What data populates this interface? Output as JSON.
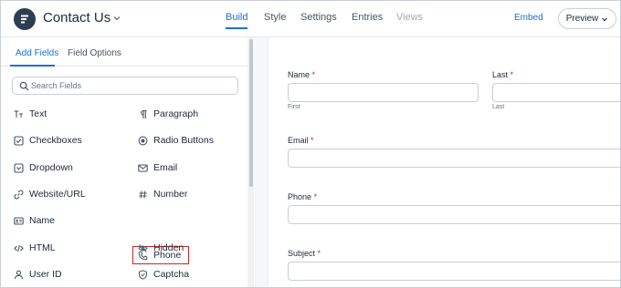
{
  "header": {
    "form_title": "Contact Us",
    "tabs": [
      {
        "label": "Build",
        "state": "active"
      },
      {
        "label": "Style",
        "state": "normal"
      },
      {
        "label": "Settings",
        "state": "normal"
      },
      {
        "label": "Entries",
        "state": "normal"
      },
      {
        "label": "Views",
        "state": "disabled"
      }
    ],
    "embed_label": "Embed",
    "preview_label": "Preview"
  },
  "sidebar": {
    "tabs": [
      {
        "label": "Add Fields",
        "state": "active"
      },
      {
        "label": "Field Options",
        "state": "normal"
      }
    ],
    "search_placeholder": "Search Fields",
    "fields": [
      {
        "label": "Text",
        "icon": "text-icon"
      },
      {
        "label": "Paragraph",
        "icon": "paragraph-icon"
      },
      {
        "label": "Checkboxes",
        "icon": "checkbox-icon"
      },
      {
        "label": "Radio Buttons",
        "icon": "radio-icon"
      },
      {
        "label": "Dropdown",
        "icon": "dropdown-icon"
      },
      {
        "label": "Email",
        "icon": "email-icon"
      },
      {
        "label": "Website/URL",
        "icon": "link-icon"
      },
      {
        "label": "Number",
        "icon": "hash-icon"
      },
      {
        "label": "Name",
        "icon": "id-card-icon"
      },
      {
        "label": "Phone",
        "icon": "phone-icon",
        "highlighted": true
      },
      {
        "label": "HTML",
        "icon": "code-icon"
      },
      {
        "label": "Hidden",
        "icon": "eye-off-icon"
      },
      {
        "label": "User ID",
        "icon": "user-icon"
      },
      {
        "label": "Captcha",
        "icon": "shield-icon"
      }
    ]
  },
  "form": {
    "name_label": "Name",
    "first_label": "Last",
    "first_sublabel": "First",
    "last_sublabel": "Last",
    "email_label": "Email",
    "phone_label": "Phone",
    "subject_label": "Subject",
    "required_mark": "*"
  },
  "colors": {
    "accent": "#1e6fd0",
    "required": "#c62828",
    "highlight_border": "#c62828",
    "logo_bg": "#2c3e50"
  }
}
